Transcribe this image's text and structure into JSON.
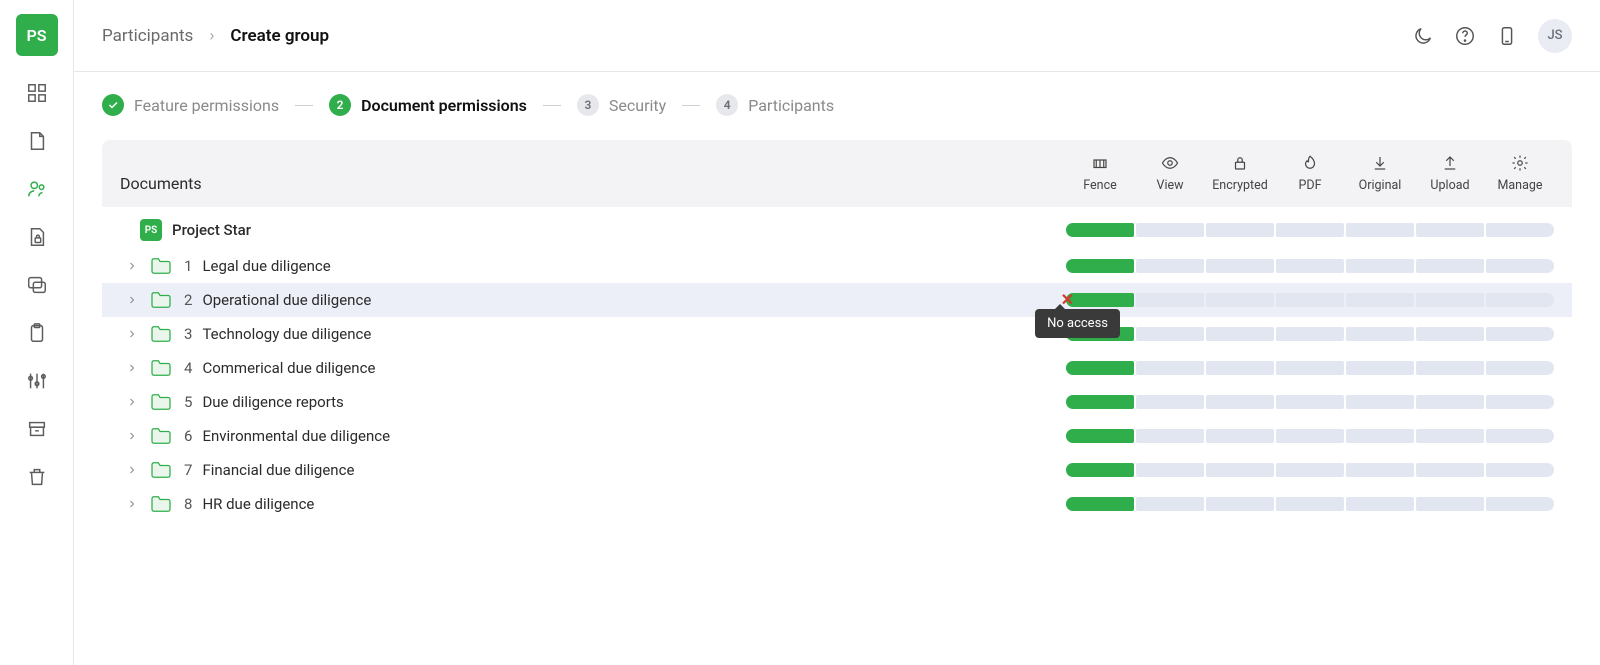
{
  "sidebar": {
    "logo_initials": "PS",
    "items": [
      {
        "name": "dashboard-icon"
      },
      {
        "name": "documents-icon"
      },
      {
        "name": "participants-icon",
        "active": true
      },
      {
        "name": "secure-docs-icon"
      },
      {
        "name": "qa-icon"
      },
      {
        "name": "clipboard-icon"
      },
      {
        "name": "settings-sliders-icon"
      },
      {
        "name": "archive-icon"
      },
      {
        "name": "trash-icon"
      }
    ]
  },
  "topbar": {
    "crumb_parent": "Participants",
    "crumb_current": "Create group",
    "user_initials": "JS"
  },
  "stepper": {
    "steps": [
      {
        "num": "✓",
        "label": "Feature permissions",
        "state": "done"
      },
      {
        "num": "2",
        "label": "Document permissions",
        "state": "current"
      },
      {
        "num": "3",
        "label": "Security",
        "state": "todo"
      },
      {
        "num": "4",
        "label": "Participants",
        "state": "todo"
      }
    ]
  },
  "panel": {
    "title": "Documents",
    "columns": [
      "Fence",
      "View",
      "Encrypted",
      "PDF",
      "Original",
      "Upload",
      "Manage"
    ]
  },
  "tree": {
    "root_badge": "PS",
    "root_label": "Project Star",
    "rows": [
      {
        "idx": "1",
        "label": "Legal due diligence"
      },
      {
        "idx": "2",
        "label": "Operational due diligence",
        "highlight": true
      },
      {
        "idx": "3",
        "label": "Technology due diligence"
      },
      {
        "idx": "4",
        "label": "Commerical due diligence"
      },
      {
        "idx": "5",
        "label": "Due diligence reports"
      },
      {
        "idx": "6",
        "label": "Environmental due diligence"
      },
      {
        "idx": "7",
        "label": "Financial due diligence"
      },
      {
        "idx": "8",
        "label": "HR due diligence"
      }
    ],
    "tooltip": "No access"
  }
}
